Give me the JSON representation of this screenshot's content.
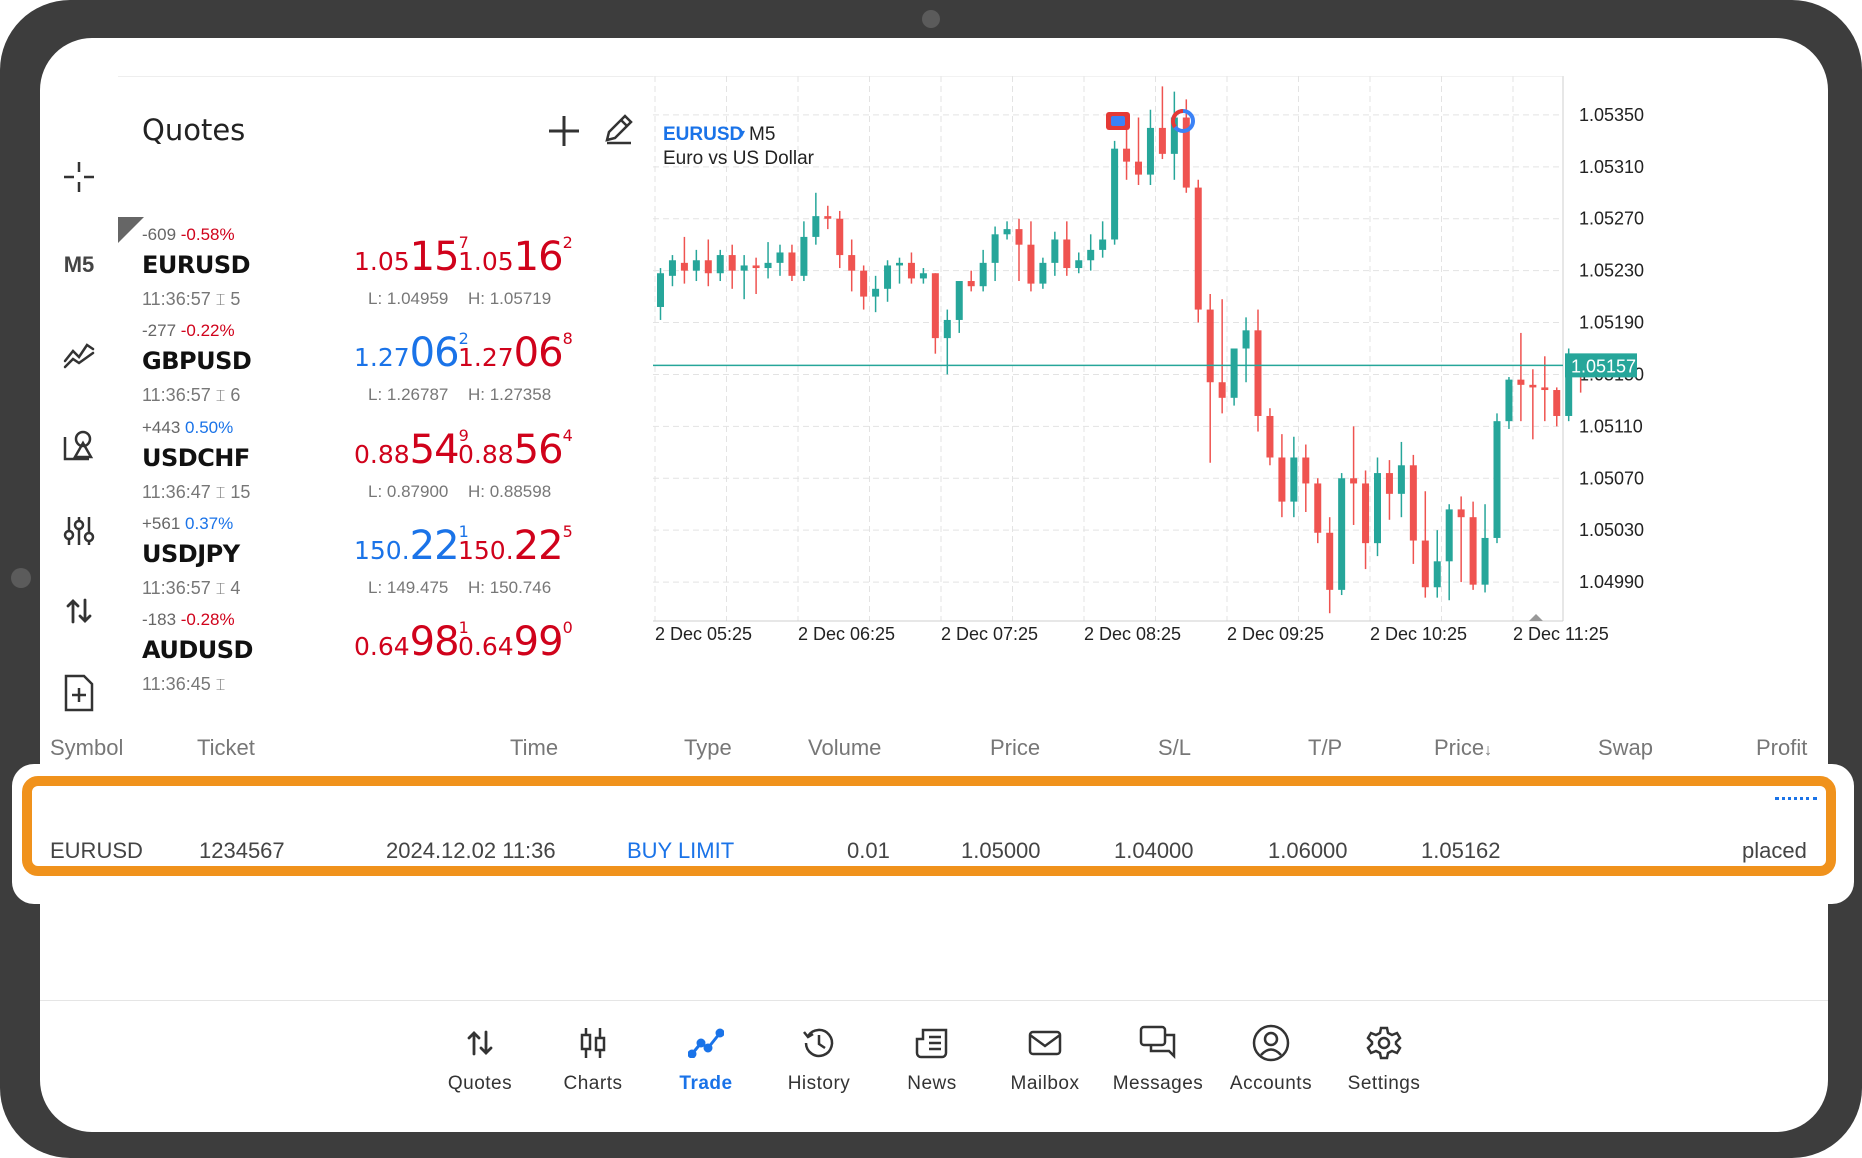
{
  "toolbar": {
    "timeframe": "M5"
  },
  "quotes_panel": {
    "title": "Quotes",
    "items": [
      {
        "change": "-609",
        "percent": "-0.58%",
        "dir": "neg",
        "symbol": "EURUSD",
        "time": "11:36:57",
        "spread": "5",
        "bid_small": "1.05",
        "bid_big": "15",
        "bid_sup": "7",
        "bid_color": "red",
        "ask_small": "1.05",
        "ask_big": "16",
        "ask_sup": "2",
        "ask_color": "red",
        "low": "L: 1.04959",
        "high": "H: 1.05719"
      },
      {
        "change": "-277",
        "percent": "-0.22%",
        "dir": "neg",
        "symbol": "GBPUSD",
        "time": "11:36:57",
        "spread": "6",
        "bid_small": "1.27",
        "bid_big": "06",
        "bid_sup": "2",
        "bid_color": "blue",
        "ask_small": "1.27",
        "ask_big": "06",
        "ask_sup": "8",
        "ask_color": "red",
        "low": "L: 1.26787",
        "high": "H: 1.27358"
      },
      {
        "change": "+443",
        "percent": "0.50%",
        "dir": "pos",
        "symbol": "USDCHF",
        "time": "11:36:47",
        "spread": "15",
        "bid_small": "0.88",
        "bid_big": "54",
        "bid_sup": "9",
        "bid_color": "red",
        "ask_small": "0.88",
        "ask_big": "56",
        "ask_sup": "4",
        "ask_color": "red",
        "low": "L: 0.87900",
        "high": "H: 0.88598"
      },
      {
        "change": "+561",
        "percent": "0.37%",
        "dir": "pos",
        "symbol": "USDJPY",
        "time": "11:36:57",
        "spread": "4",
        "bid_small": "150.",
        "bid_big": "22",
        "bid_sup": "1",
        "bid_color": "blue",
        "ask_small": "150.",
        "ask_big": "22",
        "ask_sup": "5",
        "ask_color": "red",
        "low": "L: 149.475",
        "high": "H: 150.746"
      },
      {
        "change": "-183",
        "percent": "-0.28%",
        "dir": "neg",
        "symbol": "AUDUSD",
        "time": "11:36:45",
        "spread": "",
        "bid_small": "0.64",
        "bid_big": "98",
        "bid_sup": "1",
        "bid_color": "red",
        "ask_small": "0.64",
        "ask_big": "99",
        "ask_sup": "0",
        "ask_color": "red",
        "low": "",
        "high": ""
      }
    ]
  },
  "chart": {
    "symbol": "EURUSD",
    "timeframe": "M5",
    "description": "Euro vs US Dollar",
    "price_labels": [
      "1.05350",
      "1.05310",
      "1.05270",
      "1.05230",
      "1.05190",
      "1.05150",
      "1.05110",
      "1.05070",
      "1.05030",
      "1.04990"
    ],
    "current_price": "1.05157",
    "time_labels": [
      "2 Dec 05:25",
      "2 Dec 06:25",
      "2 Dec 07:25",
      "2 Dec 08:25",
      "2 Dec 09:25",
      "2 Dec 10:25",
      "2 Dec 11:25"
    ],
    "colors": {
      "up": "#26a69a",
      "down": "#ef5350",
      "grid": "#e3e3e3",
      "price_line": "#26a69a"
    }
  },
  "chart_data": {
    "type": "candlestick",
    "ylim": [
      1.0496,
      1.0538
    ],
    "price_line": 1.05157,
    "candles": [
      [
        1.05202,
        1.05232,
        1.05228,
        1.05192
      ],
      [
        1.05226,
        1.05242,
        1.05238,
        1.05218
      ],
      [
        1.05236,
        1.05256,
        1.0523,
        1.0522
      ],
      [
        1.0523,
        1.05246,
        1.05238,
        1.05222
      ],
      [
        1.05238,
        1.05254,
        1.05228,
        1.05218
      ],
      [
        1.05228,
        1.05246,
        1.05242,
        1.05222
      ],
      [
        1.05242,
        1.0525,
        1.0523,
        1.05216
      ],
      [
        1.0523,
        1.05242,
        1.05234,
        1.05208
      ],
      [
        1.05234,
        1.0524,
        1.05232,
        1.05212
      ],
      [
        1.05232,
        1.05252,
        1.05236,
        1.05224
      ],
      [
        1.05236,
        1.0525,
        1.05244,
        1.05226
      ],
      [
        1.05244,
        1.0525,
        1.05226,
        1.05222
      ],
      [
        1.05226,
        1.05268,
        1.05256,
        1.05222
      ],
      [
        1.05256,
        1.0529,
        1.05272,
        1.0525
      ],
      [
        1.05272,
        1.0528,
        1.0527,
        1.05262
      ],
      [
        1.0527,
        1.05276,
        1.05242,
        1.05232
      ],
      [
        1.05242,
        1.05254,
        1.0523,
        1.05214
      ],
      [
        1.0523,
        1.05234,
        1.0521,
        1.052
      ],
      [
        1.0521,
        1.05226,
        1.05216,
        1.05198
      ],
      [
        1.05216,
        1.05238,
        1.05234,
        1.05206
      ],
      [
        1.05234,
        1.0524,
        1.05236,
        1.0522
      ],
      [
        1.05236,
        1.05244,
        1.05224,
        1.0522
      ],
      [
        1.05224,
        1.05232,
        1.05228,
        1.0522
      ],
      [
        1.05228,
        1.05228,
        1.05178,
        1.05166
      ],
      [
        1.05178,
        1.052,
        1.05192,
        1.0515
      ],
      [
        1.05192,
        1.05216,
        1.05222,
        1.05182
      ],
      [
        1.05222,
        1.0523,
        1.05218,
        1.05214
      ],
      [
        1.05218,
        1.05246,
        1.05236,
        1.05214
      ],
      [
        1.05236,
        1.05264,
        1.05258,
        1.05222
      ],
      [
        1.05258,
        1.05268,
        1.05262,
        1.05254
      ],
      [
        1.05262,
        1.0527,
        1.0525,
        1.05222
      ],
      [
        1.0525,
        1.05268,
        1.0522,
        1.05214
      ],
      [
        1.0522,
        1.0524,
        1.05236,
        1.05216
      ],
      [
        1.05236,
        1.0526,
        1.05254,
        1.05226
      ],
      [
        1.05254,
        1.05268,
        1.05232,
        1.05226
      ],
      [
        1.05232,
        1.05244,
        1.05238,
        1.05228
      ],
      [
        1.05238,
        1.05258,
        1.05246,
        1.0523
      ],
      [
        1.05246,
        1.05268,
        1.05254,
        1.0524
      ],
      [
        1.05254,
        1.0533,
        1.05324,
        1.0525
      ],
      [
        1.05324,
        1.0534,
        1.05314,
        1.053
      ],
      [
        1.05314,
        1.05348,
        1.05304,
        1.05296
      ],
      [
        1.05304,
        1.05354,
        1.0534,
        1.05296
      ],
      [
        1.0534,
        1.05372,
        1.0532,
        1.05316
      ],
      [
        1.0532,
        1.05368,
        1.05348,
        1.053
      ],
      [
        1.05348,
        1.05362,
        1.05294,
        1.0529
      ],
      [
        1.05294,
        1.053,
        1.052,
        1.0519
      ],
      [
        1.052,
        1.05212,
        1.05144,
        1.05082
      ],
      [
        1.05144,
        1.05208,
        1.05132,
        1.0512
      ],
      [
        1.05132,
        1.05142,
        1.0517,
        1.05126
      ],
      [
        1.0517,
        1.05194,
        1.05184,
        1.05144
      ],
      [
        1.05184,
        1.052,
        1.05118,
        1.05106
      ],
      [
        1.05118,
        1.05124,
        1.05086,
        1.0508
      ],
      [
        1.05086,
        1.05104,
        1.05052,
        1.0504
      ],
      [
        1.05052,
        1.05102,
        1.05086,
        1.0504
      ],
      [
        1.05086,
        1.05096,
        1.05066,
        1.05044
      ],
      [
        1.05066,
        1.0507,
        1.05028,
        1.0502
      ],
      [
        1.05028,
        1.0504,
        1.04984,
        1.04966
      ],
      [
        1.04984,
        1.05074,
        1.0507,
        1.0498
      ],
      [
        1.0507,
        1.0511,
        1.05066,
        1.05034
      ],
      [
        1.05066,
        1.05076,
        1.0502,
        1.05
      ],
      [
        1.0502,
        1.05086,
        1.05074,
        1.0501
      ],
      [
        1.05074,
        1.05084,
        1.05058,
        1.05038
      ],
      [
        1.05058,
        1.05098,
        1.0508,
        1.0504
      ],
      [
        1.0508,
        1.05088,
        1.05022,
        1.05004
      ],
      [
        1.05022,
        1.0506,
        1.04986,
        1.04978
      ],
      [
        1.04986,
        1.0503,
        1.05006,
        1.04978
      ],
      [
        1.05006,
        1.0505,
        1.05046,
        1.04976
      ],
      [
        1.05046,
        1.05056,
        1.0504,
        1.0499
      ],
      [
        1.0504,
        1.05052,
        1.04988,
        1.04984
      ],
      [
        1.04988,
        1.0505,
        1.05024,
        1.04982
      ],
      [
        1.05024,
        1.0512,
        1.05114,
        1.0502
      ],
      [
        1.05114,
        1.05148,
        1.05146,
        1.05108
      ],
      [
        1.05146,
        1.05182,
        1.05142,
        1.05114
      ],
      [
        1.05142,
        1.05154,
        1.0514,
        1.051
      ],
      [
        1.0514,
        1.05164,
        1.05138,
        1.05114
      ],
      [
        1.05138,
        1.0514,
        1.05118,
        1.0511
      ],
      [
        1.05118,
        1.0517,
        1.05158,
        1.05114
      ],
      [
        1.05158,
        1.05166,
        1.05154,
        1.05136
      ]
    ]
  },
  "trades": {
    "columns": [
      "Symbol",
      "Ticket",
      "Time",
      "Type",
      "Volume",
      "Price",
      "S/L",
      "T/P",
      "Price",
      "Swap",
      "Profit"
    ],
    "sort_arrow": "↓",
    "rows": [
      {
        "symbol": "EURUSD",
        "ticket": "1234567",
        "time": "2024.12.02 11:36",
        "type": "BUY LIMIT",
        "volume": "0.01",
        "price": "1.05000",
        "sl": "1.04000",
        "tp": "1.06000",
        "current_price": "1.05162",
        "swap": "",
        "profit": "placed"
      }
    ],
    "highlight_color": "#f0921c"
  },
  "bottom_nav": {
    "items": [
      {
        "label": "Quotes",
        "icon": "quotes-arrows-icon"
      },
      {
        "label": "Charts",
        "icon": "candles-icon"
      },
      {
        "label": "Trade",
        "icon": "trade-line-icon"
      },
      {
        "label": "History",
        "icon": "history-icon"
      },
      {
        "label": "News",
        "icon": "news-icon"
      },
      {
        "label": "Mailbox",
        "icon": "mailbox-icon"
      },
      {
        "label": "Messages",
        "icon": "messages-icon"
      },
      {
        "label": "Accounts",
        "icon": "accounts-icon"
      },
      {
        "label": "Settings",
        "icon": "settings-icon"
      }
    ],
    "active": "Trade",
    "active_color": "#1a73e8"
  }
}
